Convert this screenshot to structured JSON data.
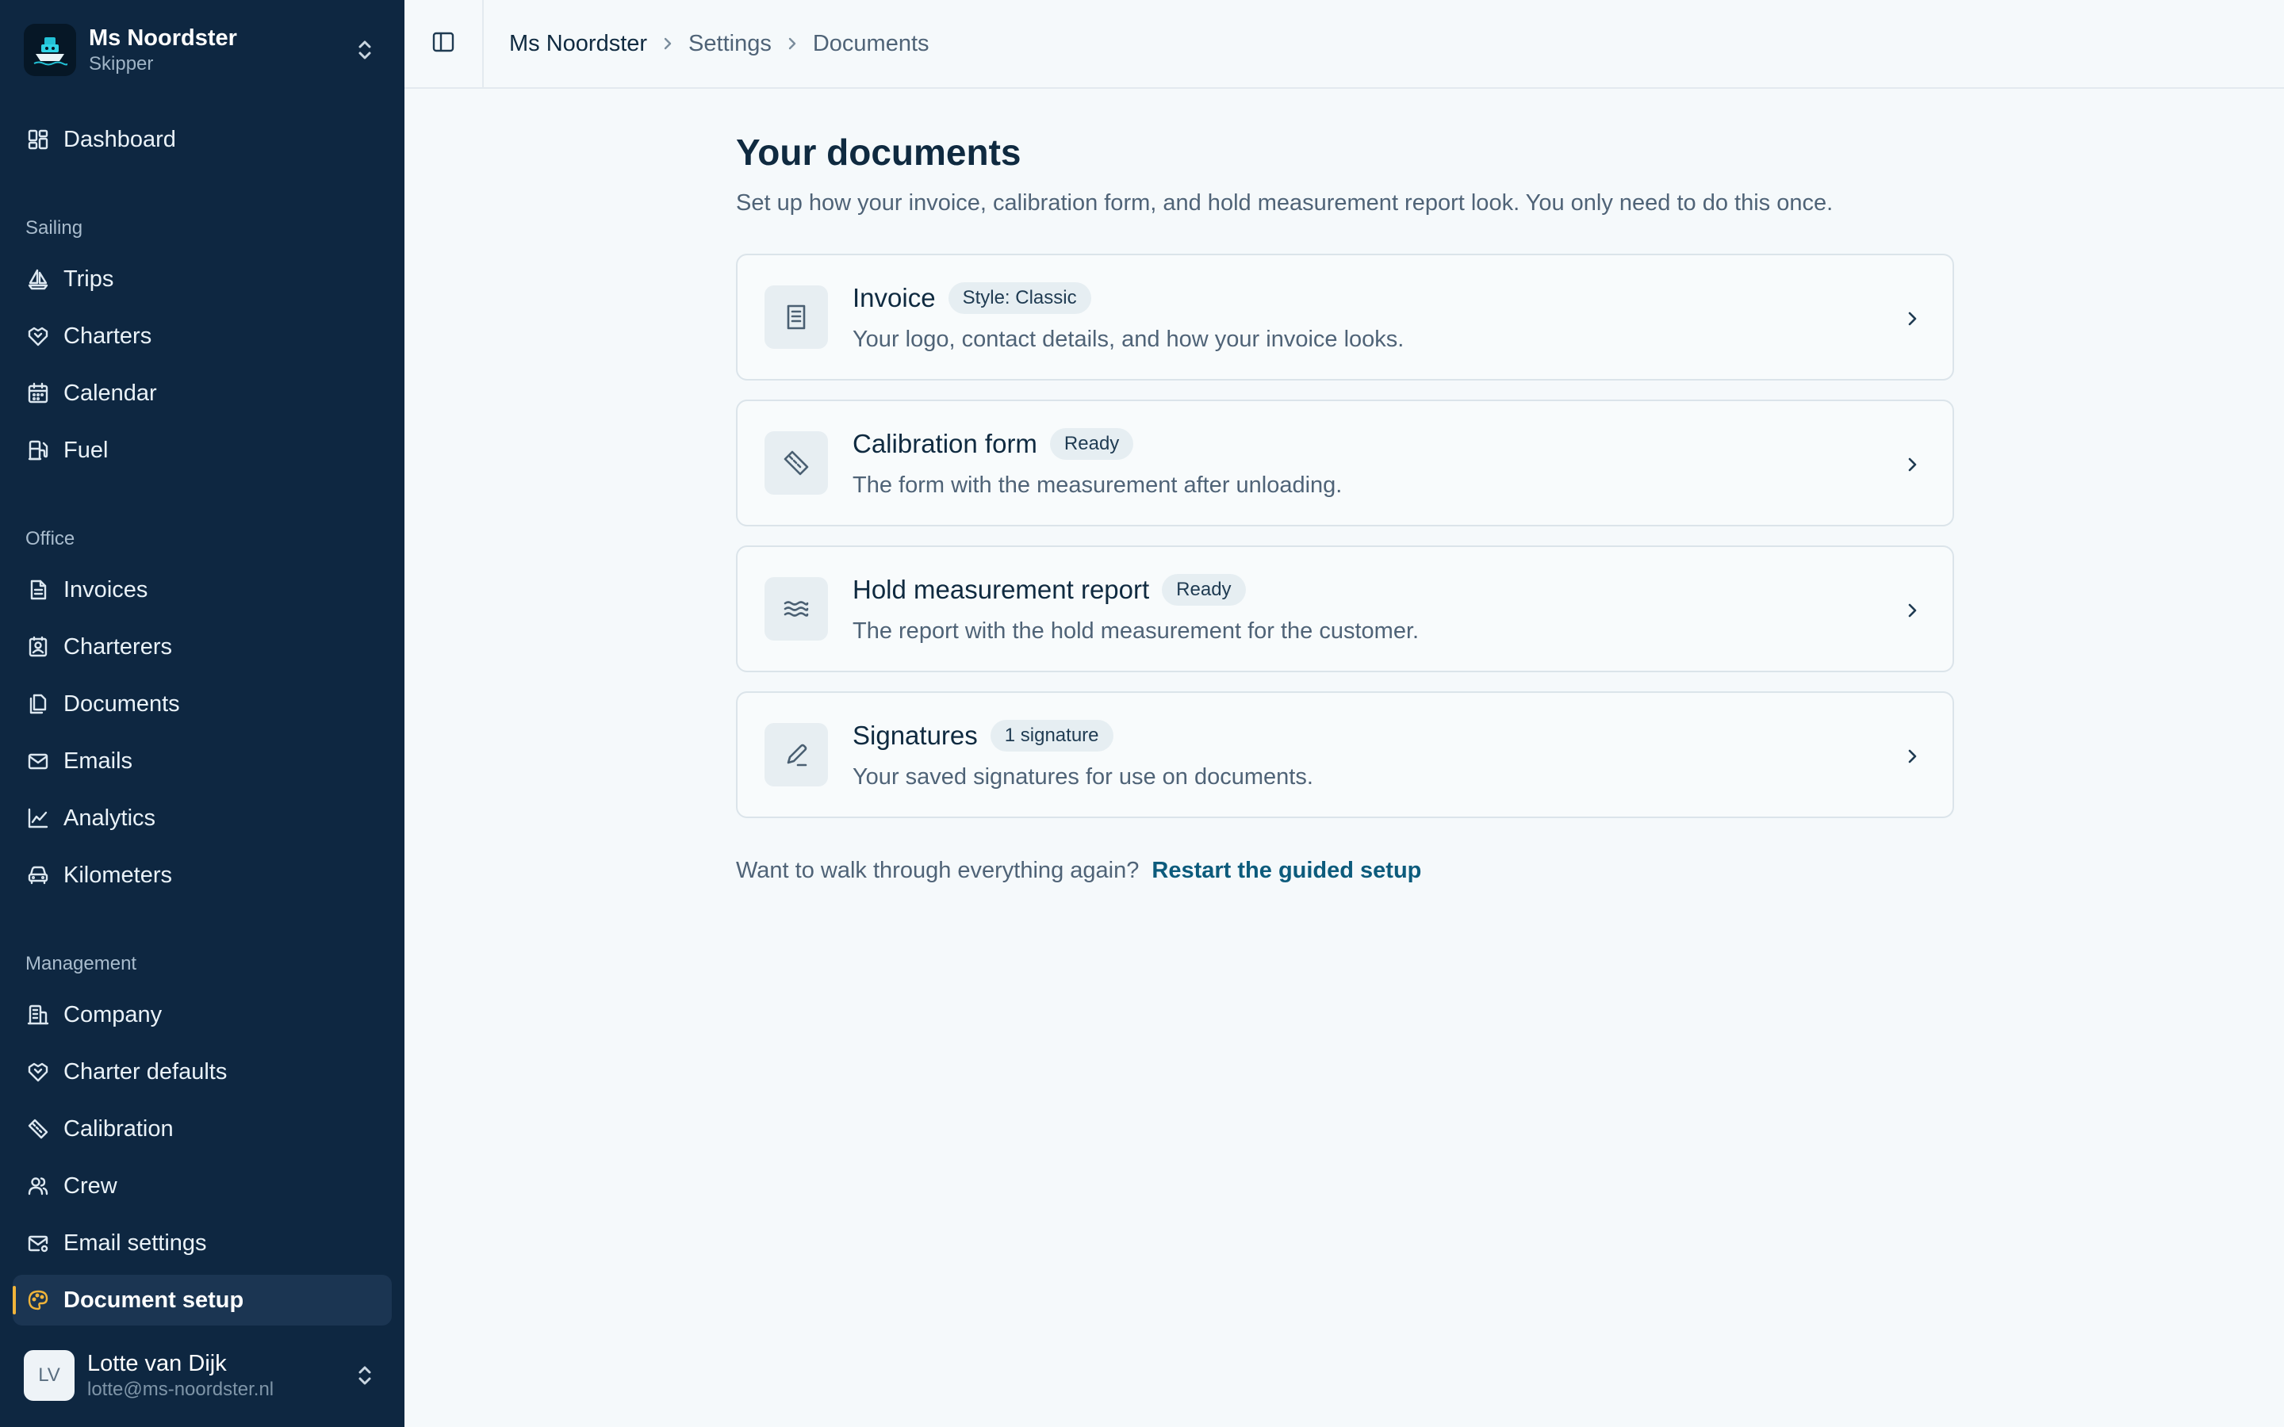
{
  "vessel": {
    "name": "Ms Noordster",
    "role": "Skipper"
  },
  "nav": {
    "dashboard": "Dashboard",
    "sections": [
      {
        "label": "Sailing",
        "items": [
          "Trips",
          "Charters",
          "Calendar",
          "Fuel"
        ]
      },
      {
        "label": "Office",
        "items": [
          "Invoices",
          "Charterers",
          "Documents",
          "Emails",
          "Analytics",
          "Kilometers"
        ]
      },
      {
        "label": "Management",
        "items": [
          "Company",
          "Charter defaults",
          "Calibration",
          "Crew",
          "Email settings",
          "Document setup"
        ]
      }
    ],
    "active": "Document setup"
  },
  "user": {
    "initials": "LV",
    "name": "Lotte van Dijk",
    "email": "lotte@ms-noordster.nl"
  },
  "breadcrumb": [
    "Ms Noordster",
    "Settings",
    "Documents"
  ],
  "page": {
    "title": "Your documents",
    "subtitle": "Set up how your invoice, calibration form, and hold measurement report look. You only need to do this once."
  },
  "cards": [
    {
      "title": "Invoice",
      "badge": "Style: Classic",
      "description": "Your logo, contact details, and how your invoice looks.",
      "icon": "receipt-icon"
    },
    {
      "title": "Calibration form",
      "badge": "Ready",
      "description": "The form with the measurement after unloading.",
      "icon": "ruler-icon"
    },
    {
      "title": "Hold measurement report",
      "badge": "Ready",
      "description": "The report with the hold measurement for the customer.",
      "icon": "waves-icon"
    },
    {
      "title": "Signatures",
      "badge": "1 signature",
      "description": "Your saved signatures for use on documents.",
      "icon": "pen-icon"
    }
  ],
  "restart": {
    "question": "Want to walk through everything again?",
    "link": "Restart the guided setup"
  },
  "colors": {
    "sidebar": "#0e2741",
    "accent": "#f0b43a",
    "link": "#0c5b7c"
  }
}
